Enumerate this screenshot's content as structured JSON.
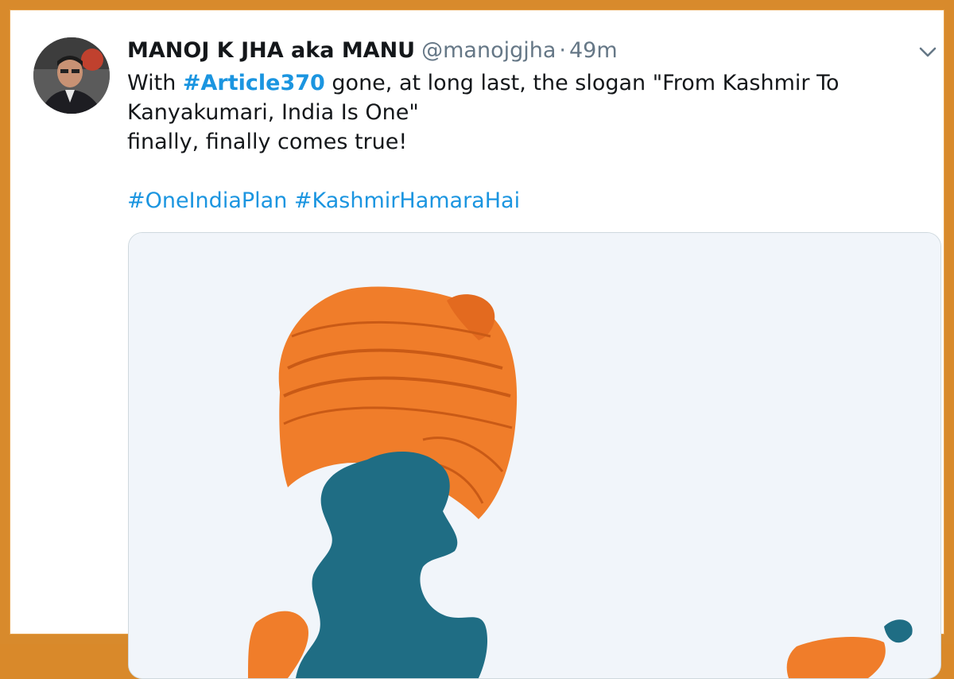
{
  "tweet": {
    "author": {
      "display_name": "MANOJ K JHA aka MANU",
      "handle": "@manojgjha",
      "avatar": "avatar"
    },
    "separator": "·",
    "timestamp": "49m",
    "menu_icon": "chevron-down-icon",
    "text": {
      "line1_before": "With ",
      "line1_hashtag": "#Article370",
      "line1_after": " gone, at long last, the slogan \"From Kashmir To",
      "line2": "Kanyakumari, India Is One\"",
      "line3": "finally, finally comes true!"
    },
    "hashtags": [
      "#OneIndiaPlan",
      "#KashmirHamaraHai"
    ]
  },
  "colors": {
    "frame": "#d88a2c",
    "link": "#1b95e0",
    "turban": "#f07d2a",
    "map": "#1f6d84"
  }
}
